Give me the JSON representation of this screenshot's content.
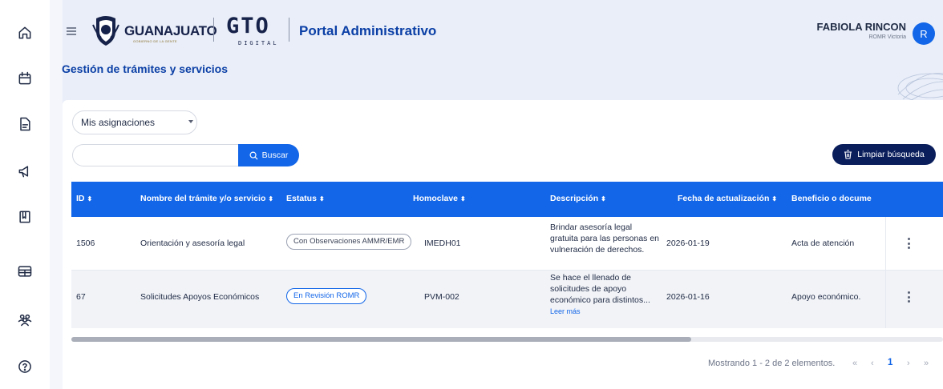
{
  "header": {
    "brand_name": "GUANAJUATO",
    "brand_tagline": "GOBIERNO DE LA GENTE",
    "gto_logo": "GTO",
    "gto_sub": "DIGITAL",
    "portal_title": "Portal Administrativo",
    "user_name": "FABIOLA RINCON",
    "user_role": "ROMR Victoria",
    "avatar_initial": "R"
  },
  "page": {
    "title": "Gestión de trámites y servicios"
  },
  "sidebar": {
    "items": [
      {
        "icon": "home-icon"
      },
      {
        "icon": "calendar-icon"
      },
      {
        "icon": "document-icon"
      },
      {
        "icon": "megaphone-icon"
      },
      {
        "icon": "book-icon"
      },
      {
        "icon": "table-icon"
      },
      {
        "icon": "users-icon"
      },
      {
        "icon": "help-icon"
      }
    ]
  },
  "filters": {
    "select_value": "Mis asignaciones",
    "search_placeholder": "",
    "search_label": "Buscar",
    "clear_label": "Limpiar búsqueda"
  },
  "table": {
    "headers": [
      "ID",
      "Nombre del trámite y/o servicio",
      "Estatus",
      "Homoclave",
      "Descripción",
      "Fecha de actualización",
      "Beneficio o docume"
    ],
    "rows": [
      {
        "id": "1506",
        "name": "Orientación y asesoría legal",
        "status": "Con Observaciones AMMR/EMR",
        "homoclave": "IMEDH01",
        "description": "Brindar asesoría legal gratuita para las personas en vulneración de derechos.",
        "date": "2026-01-19",
        "benefit": "Acta de atención"
      },
      {
        "id": "67",
        "name": "Solicitudes Apoyos Económicos",
        "status": "En Revisión ROMR",
        "homoclave": "PVM-002",
        "description": "Se hace el llenado de solicitudes de apoyo económico para distintos...",
        "read_more": "Leer más",
        "date": "2026-01-16",
        "benefit": "Apoyo económico."
      }
    ]
  },
  "pagination": {
    "summary": "Mostrando 1 - 2 de 2 elementos.",
    "first": "«",
    "prev": "‹",
    "current": "1",
    "next": "›",
    "last": "»"
  },
  "colors": {
    "primary": "#1366e8",
    "dark_navy": "#0a1e5c",
    "title_blue": "#0b3fa6",
    "header_bg": "#e9eef8"
  }
}
